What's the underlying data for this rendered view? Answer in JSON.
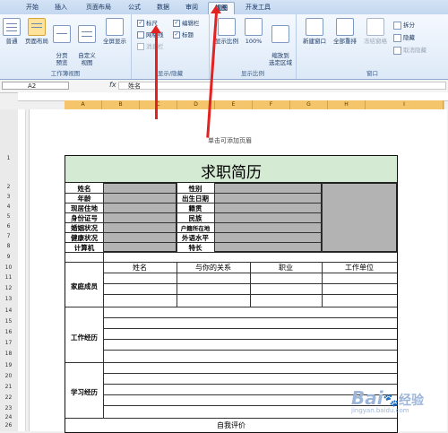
{
  "ribbon": {
    "tabs": [
      "开始",
      "插入",
      "页面布局",
      "公式",
      "数据",
      "审阅",
      "视图",
      "开发工具"
    ],
    "active_tab": "视图",
    "view_group": {
      "label": "工作簿视图",
      "buttons": [
        "普通",
        "页面布局",
        "分页\n预览",
        "自定义\n视图",
        "全屏显示"
      ]
    },
    "show_group": {
      "label": "显示/隐藏",
      "checks": [
        {
          "label": "标尺",
          "checked": true
        },
        {
          "label": "网格线",
          "checked": false
        },
        {
          "label": "消息栏",
          "checked": false
        },
        {
          "label": "编辑栏",
          "checked": true
        },
        {
          "label": "标题",
          "checked": true
        }
      ]
    },
    "zoom_group": {
      "label": "显示比例",
      "buttons": [
        "显示比例",
        "100%",
        "缩放到\n选定区域"
      ]
    },
    "window_group": {
      "label": "窗口",
      "buttons": [
        "新建窗口",
        "全部重排",
        "冻结窗格"
      ],
      "small": [
        "拆分",
        "隐藏",
        "取消隐藏"
      ]
    }
  },
  "formula_bar": {
    "cell_ref": "A2",
    "fx": "fx",
    "value": "姓名"
  },
  "columns": [
    "A",
    "B",
    "C",
    "D",
    "E",
    "F",
    "G",
    "H",
    "I"
  ],
  "rows": [
    "1",
    "2",
    "3",
    "4",
    "5",
    "6",
    "7",
    "8",
    "9",
    "10",
    "11",
    "12",
    "13",
    "14",
    "15",
    "16",
    "17",
    "18",
    "19",
    "20",
    "21",
    "22",
    "23",
    "24",
    "25",
    "26"
  ],
  "page_hint": "单击可添加页眉",
  "resume": {
    "title": "求职简历",
    "left_labels": [
      "姓名",
      "年龄",
      "现居住地",
      "身份证号",
      "婚姻状况",
      "健康状况",
      "计算机"
    ],
    "mid_labels": [
      "性别",
      "出生日期",
      "籍贯",
      "民族",
      "户籍所在地",
      "外语水平",
      "特长"
    ],
    "family_headers": [
      "姓名",
      "与你的关系",
      "职业",
      "工作单位"
    ],
    "family_label": "家庭成员",
    "work_label": "工作经历",
    "study_label": "学习经历",
    "self_label": "自我评价"
  },
  "watermark": {
    "brand": "Bai",
    "brand_cn": "经验",
    "url": "jingyan.baidu.com"
  }
}
